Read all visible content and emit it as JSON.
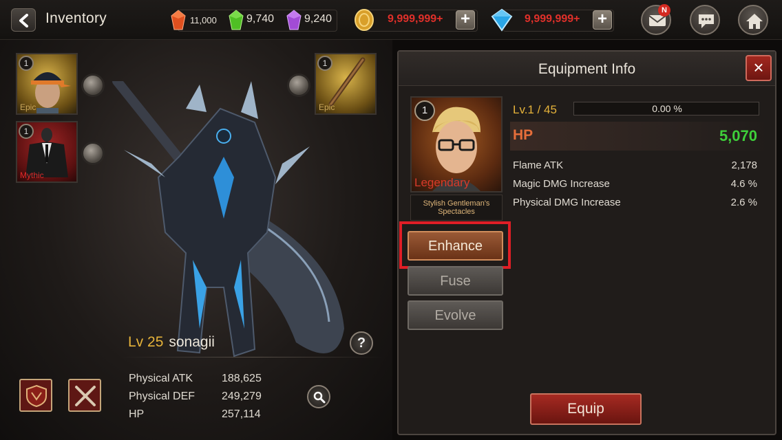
{
  "header": {
    "title": "Inventory",
    "currencies": [
      {
        "icon": "red-gem-icon",
        "value": "11,000",
        "color": "#e0501f"
      },
      {
        "icon": "green-gem-icon",
        "value": "9,740",
        "color": "#4fbf24"
      },
      {
        "icon": "purple-gem-icon",
        "value": "9,240",
        "color": "#a24bd6"
      }
    ],
    "gold": {
      "icon": "gold-coin-icon",
      "value": "9,999,999+"
    },
    "diamonds": {
      "icon": "diamond-icon",
      "value": "9,999,999+"
    },
    "plus": "+",
    "mail_badge": "N"
  },
  "character": {
    "slots": [
      {
        "level": "1",
        "rarity": "Epic",
        "rarity_color": "#caa75a"
      },
      {
        "level": "1",
        "rarity": "Mythic",
        "rarity_color": "#e02a2a"
      },
      {
        "level": "1",
        "rarity": "Epic",
        "rarity_color": "#caa75a"
      }
    ],
    "level": "Lv 25",
    "name": "sonagii",
    "help": "?",
    "stats": [
      {
        "label": "Physical ATK",
        "value": "188,625"
      },
      {
        "label": "Physical DEF",
        "value": "249,279"
      },
      {
        "label": "HP",
        "value": "257,114"
      }
    ]
  },
  "equipment_info": {
    "title": "Equipment Info",
    "close": "×",
    "item": {
      "level": "1",
      "rarity": "Legendary",
      "name": "Stylish Gentleman's Spectacles"
    },
    "actions": {
      "enhance": "Enhance",
      "fuse": "Fuse",
      "evolve": "Evolve"
    },
    "item_level": "Lv.1 / 45",
    "xp_progress": 0.0,
    "xp_text": "0.00 %",
    "main_stat": {
      "label": "HP",
      "value": "5,070"
    },
    "attributes": [
      {
        "label": "Flame ATK",
        "value": "2,178"
      },
      {
        "label": "Magic DMG Increase",
        "value": "4.6 %"
      },
      {
        "label": "Physical DMG Increase",
        "value": "2.6 %"
      }
    ],
    "equip": "Equip"
  }
}
